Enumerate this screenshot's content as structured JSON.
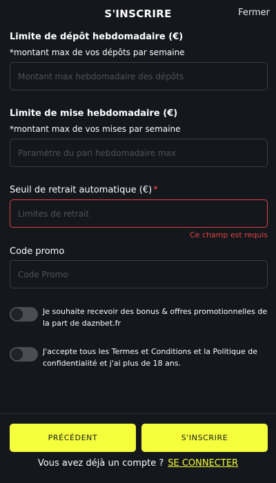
{
  "header": {
    "title": "S'INSCRIRE",
    "close_label": "Fermer"
  },
  "form": {
    "deposit_limit": {
      "label": "Limite de dépôt hebdomadaire (€)",
      "sublabel": "*montant max de vos dépôts par semaine",
      "placeholder": "Montant max hebdomadaire des dépôts",
      "value": ""
    },
    "bet_limit": {
      "label": "Limite de mise hebdomadaire (€)",
      "sublabel": "*montant max de vos mises par semaine",
      "placeholder": "Paramètre du pari hebdomadaire max",
      "value": ""
    },
    "withdrawal_threshold": {
      "label": "Seuil de retrait automatique (€)",
      "required_marker": "*",
      "placeholder": "Limites de retrait",
      "value": "",
      "error": "Ce champ est requis"
    },
    "promo_code": {
      "label": "Code promo",
      "placeholder": "Code Promo",
      "value": ""
    },
    "toggles": [
      {
        "text": "Je souhaite recevoir des bonus & offres promotionnelles de la part de daznbet.fr",
        "checked": false
      },
      {
        "text": "J'accepte tous les Termes et Conditions et la Politique de confidentialité et j'ai plus de 18 ans.",
        "checked": false
      }
    ]
  },
  "footer": {
    "previous_label": "PRÉCÉDENT",
    "signup_label": "S'INSCRIRE",
    "login_prompt": "Vous avez déjà un compte ?",
    "login_link": "SE CONNECTER"
  },
  "colors": {
    "background": "#14171c",
    "accent": "#f5ff3c",
    "error": "#e04444",
    "input_border": "#3a3f46"
  }
}
